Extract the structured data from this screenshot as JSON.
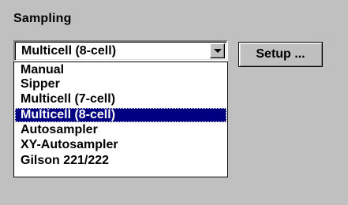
{
  "group": {
    "title": "Sampling"
  },
  "combo": {
    "value": "Multicell (8-cell)"
  },
  "dropdown": {
    "items": [
      {
        "label": "Manual"
      },
      {
        "label": "Sipper"
      },
      {
        "label": "Multicell (7-cell)"
      },
      {
        "label": "Multicell (8-cell)",
        "selected": true
      },
      {
        "label": "Autosampler"
      },
      {
        "label": "XY-Autosampler"
      },
      {
        "label": "Gilson 221/222"
      }
    ]
  },
  "setup_button": {
    "label": "Setup ..."
  },
  "colors": {
    "panel": "#c0c0c0",
    "selection": "#000080",
    "selection_text": "#ffffff"
  },
  "icons": {
    "dropdown_arrow": "chevron-down-icon"
  }
}
